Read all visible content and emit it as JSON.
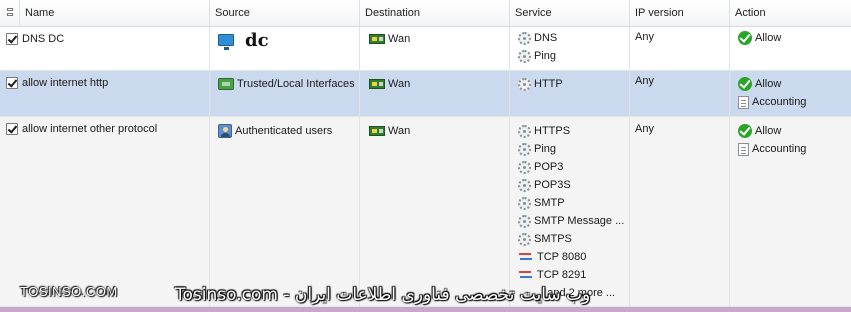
{
  "columns": [
    "Name",
    "Source",
    "Destination",
    "Service",
    "IP version",
    "Action"
  ],
  "rules": [
    {
      "checked": true,
      "name": "DNS DC",
      "source": {
        "icon": "computer-icon",
        "label": "",
        "overlay": "dc"
      },
      "destination": {
        "icon": "network-icon",
        "label": "Wan"
      },
      "services": [
        {
          "icon": "gear-icon",
          "label": "DNS"
        },
        {
          "icon": "gear-icon",
          "label": "Ping"
        }
      ],
      "ip_version": "Any",
      "actions": [
        {
          "icon": "allow-check-icon",
          "label": "Allow"
        }
      ]
    },
    {
      "checked": true,
      "name": "allow internet http",
      "source": {
        "icon": "trusted-interfaces-icon",
        "label": "Trusted/Local Interfaces"
      },
      "destination": {
        "icon": "network-icon",
        "label": "Wan"
      },
      "services": [
        {
          "icon": "gear-icon",
          "label": "HTTP"
        }
      ],
      "ip_version": "Any",
      "actions": [
        {
          "icon": "allow-check-icon",
          "label": "Allow"
        },
        {
          "icon": "document-icon",
          "label": "Accounting"
        }
      ]
    },
    {
      "checked": true,
      "name": "allow internet other protocol",
      "source": {
        "icon": "users-icon",
        "label": "Authenticated users"
      },
      "destination": {
        "icon": "network-icon",
        "label": "Wan"
      },
      "services": [
        {
          "icon": "gear-icon",
          "label": "HTTPS"
        },
        {
          "icon": "gear-icon",
          "label": "Ping"
        },
        {
          "icon": "gear-icon",
          "label": "POP3"
        },
        {
          "icon": "gear-icon",
          "label": "POP3S"
        },
        {
          "icon": "gear-icon",
          "label": "SMTP"
        },
        {
          "icon": "gear-icon",
          "label": "SMTP Message ..."
        },
        {
          "icon": "gear-icon",
          "label": "SMTPS"
        },
        {
          "icon": "tcp-port-icon",
          "label": "TCP 8080"
        },
        {
          "icon": "tcp-port-icon",
          "label": "TCP 8291"
        },
        {
          "icon": "",
          "label": "... and 2 more ..."
        }
      ],
      "ip_version": "Any",
      "actions": [
        {
          "icon": "allow-check-icon",
          "label": "Allow"
        },
        {
          "icon": "document-icon",
          "label": "Accounting"
        }
      ]
    }
  ],
  "watermark": {
    "left": "TOSINSO.COM",
    "center": "وب سایت تخصصی فناوری اطلاعات ایران - Tosinso.com"
  }
}
